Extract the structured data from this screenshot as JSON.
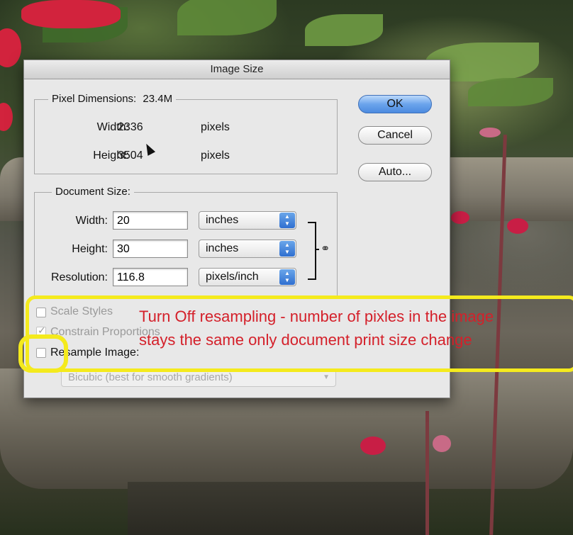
{
  "dialog": {
    "title": "Image Size"
  },
  "pixel_dimensions": {
    "heading": "Pixel Dimensions:",
    "size": "23.4M",
    "width_label": "Width:",
    "width_value": "2336",
    "width_unit": "pixels",
    "height_label": "Height:",
    "height_value": "3504",
    "height_unit": "pixels"
  },
  "document_size": {
    "heading": "Document Size:",
    "width_label": "Width:",
    "width_value": "20",
    "width_unit": "inches",
    "height_label": "Height:",
    "height_value": "30",
    "height_unit": "inches",
    "resolution_label": "Resolution:",
    "resolution_value": "116.8",
    "resolution_unit": "pixels/inch"
  },
  "buttons": {
    "ok": "OK",
    "cancel": "Cancel",
    "auto": "Auto..."
  },
  "options": {
    "scale_styles": "Scale Styles",
    "constrain_proportions": "Constrain Proportions",
    "resample_image": "Resample Image:",
    "resample_method": "Bicubic (best for smooth gradients)"
  },
  "annotation": {
    "line1": "Turn Off resampling - number of pixles in the image",
    "line2": "stays the same only document print size change",
    "color": "#d4202a",
    "highlight_color": "#f4ea1d"
  }
}
